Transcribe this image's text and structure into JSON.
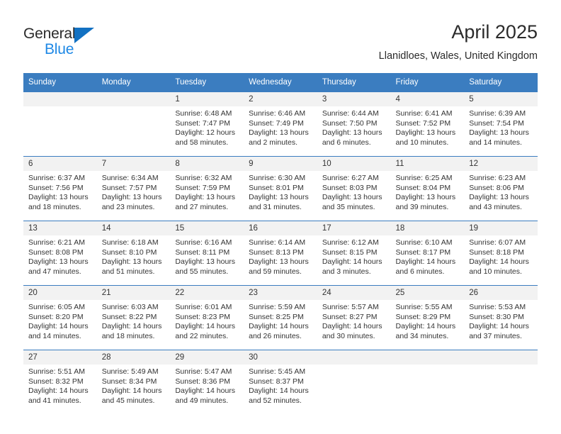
{
  "brand": {
    "name_primary": "General",
    "name_secondary": "Blue",
    "accent_color": "#1271c2",
    "secondary_color": "#1e88e5"
  },
  "header": {
    "title": "April 2025",
    "subtitle": "Llanidloes, Wales, United Kingdom"
  },
  "calendar": {
    "header_bg": "#3b7dc0",
    "daynum_bg": "#f2f2f2",
    "weekday_headers": [
      "Sunday",
      "Monday",
      "Tuesday",
      "Wednesday",
      "Thursday",
      "Friday",
      "Saturday"
    ],
    "weeks": [
      [
        {
          "day": "",
          "sunrise": "",
          "sunset": "",
          "daylight_a": "",
          "daylight_b": ""
        },
        {
          "day": "",
          "sunrise": "",
          "sunset": "",
          "daylight_a": "",
          "daylight_b": ""
        },
        {
          "day": "1",
          "sunrise": "Sunrise: 6:48 AM",
          "sunset": "Sunset: 7:47 PM",
          "daylight_a": "Daylight: 12 hours",
          "daylight_b": "and 58 minutes."
        },
        {
          "day": "2",
          "sunrise": "Sunrise: 6:46 AM",
          "sunset": "Sunset: 7:49 PM",
          "daylight_a": "Daylight: 13 hours",
          "daylight_b": "and 2 minutes."
        },
        {
          "day": "3",
          "sunrise": "Sunrise: 6:44 AM",
          "sunset": "Sunset: 7:50 PM",
          "daylight_a": "Daylight: 13 hours",
          "daylight_b": "and 6 minutes."
        },
        {
          "day": "4",
          "sunrise": "Sunrise: 6:41 AM",
          "sunset": "Sunset: 7:52 PM",
          "daylight_a": "Daylight: 13 hours",
          "daylight_b": "and 10 minutes."
        },
        {
          "day": "5",
          "sunrise": "Sunrise: 6:39 AM",
          "sunset": "Sunset: 7:54 PM",
          "daylight_a": "Daylight: 13 hours",
          "daylight_b": "and 14 minutes."
        }
      ],
      [
        {
          "day": "6",
          "sunrise": "Sunrise: 6:37 AM",
          "sunset": "Sunset: 7:56 PM",
          "daylight_a": "Daylight: 13 hours",
          "daylight_b": "and 18 minutes."
        },
        {
          "day": "7",
          "sunrise": "Sunrise: 6:34 AM",
          "sunset": "Sunset: 7:57 PM",
          "daylight_a": "Daylight: 13 hours",
          "daylight_b": "and 23 minutes."
        },
        {
          "day": "8",
          "sunrise": "Sunrise: 6:32 AM",
          "sunset": "Sunset: 7:59 PM",
          "daylight_a": "Daylight: 13 hours",
          "daylight_b": "and 27 minutes."
        },
        {
          "day": "9",
          "sunrise": "Sunrise: 6:30 AM",
          "sunset": "Sunset: 8:01 PM",
          "daylight_a": "Daylight: 13 hours",
          "daylight_b": "and 31 minutes."
        },
        {
          "day": "10",
          "sunrise": "Sunrise: 6:27 AM",
          "sunset": "Sunset: 8:03 PM",
          "daylight_a": "Daylight: 13 hours",
          "daylight_b": "and 35 minutes."
        },
        {
          "day": "11",
          "sunrise": "Sunrise: 6:25 AM",
          "sunset": "Sunset: 8:04 PM",
          "daylight_a": "Daylight: 13 hours",
          "daylight_b": "and 39 minutes."
        },
        {
          "day": "12",
          "sunrise": "Sunrise: 6:23 AM",
          "sunset": "Sunset: 8:06 PM",
          "daylight_a": "Daylight: 13 hours",
          "daylight_b": "and 43 minutes."
        }
      ],
      [
        {
          "day": "13",
          "sunrise": "Sunrise: 6:21 AM",
          "sunset": "Sunset: 8:08 PM",
          "daylight_a": "Daylight: 13 hours",
          "daylight_b": "and 47 minutes."
        },
        {
          "day": "14",
          "sunrise": "Sunrise: 6:18 AM",
          "sunset": "Sunset: 8:10 PM",
          "daylight_a": "Daylight: 13 hours",
          "daylight_b": "and 51 minutes."
        },
        {
          "day": "15",
          "sunrise": "Sunrise: 6:16 AM",
          "sunset": "Sunset: 8:11 PM",
          "daylight_a": "Daylight: 13 hours",
          "daylight_b": "and 55 minutes."
        },
        {
          "day": "16",
          "sunrise": "Sunrise: 6:14 AM",
          "sunset": "Sunset: 8:13 PM",
          "daylight_a": "Daylight: 13 hours",
          "daylight_b": "and 59 minutes."
        },
        {
          "day": "17",
          "sunrise": "Sunrise: 6:12 AM",
          "sunset": "Sunset: 8:15 PM",
          "daylight_a": "Daylight: 14 hours",
          "daylight_b": "and 3 minutes."
        },
        {
          "day": "18",
          "sunrise": "Sunrise: 6:10 AM",
          "sunset": "Sunset: 8:17 PM",
          "daylight_a": "Daylight: 14 hours",
          "daylight_b": "and 6 minutes."
        },
        {
          "day": "19",
          "sunrise": "Sunrise: 6:07 AM",
          "sunset": "Sunset: 8:18 PM",
          "daylight_a": "Daylight: 14 hours",
          "daylight_b": "and 10 minutes."
        }
      ],
      [
        {
          "day": "20",
          "sunrise": "Sunrise: 6:05 AM",
          "sunset": "Sunset: 8:20 PM",
          "daylight_a": "Daylight: 14 hours",
          "daylight_b": "and 14 minutes."
        },
        {
          "day": "21",
          "sunrise": "Sunrise: 6:03 AM",
          "sunset": "Sunset: 8:22 PM",
          "daylight_a": "Daylight: 14 hours",
          "daylight_b": "and 18 minutes."
        },
        {
          "day": "22",
          "sunrise": "Sunrise: 6:01 AM",
          "sunset": "Sunset: 8:23 PM",
          "daylight_a": "Daylight: 14 hours",
          "daylight_b": "and 22 minutes."
        },
        {
          "day": "23",
          "sunrise": "Sunrise: 5:59 AM",
          "sunset": "Sunset: 8:25 PM",
          "daylight_a": "Daylight: 14 hours",
          "daylight_b": "and 26 minutes."
        },
        {
          "day": "24",
          "sunrise": "Sunrise: 5:57 AM",
          "sunset": "Sunset: 8:27 PM",
          "daylight_a": "Daylight: 14 hours",
          "daylight_b": "and 30 minutes."
        },
        {
          "day": "25",
          "sunrise": "Sunrise: 5:55 AM",
          "sunset": "Sunset: 8:29 PM",
          "daylight_a": "Daylight: 14 hours",
          "daylight_b": "and 34 minutes."
        },
        {
          "day": "26",
          "sunrise": "Sunrise: 5:53 AM",
          "sunset": "Sunset: 8:30 PM",
          "daylight_a": "Daylight: 14 hours",
          "daylight_b": "and 37 minutes."
        }
      ],
      [
        {
          "day": "27",
          "sunrise": "Sunrise: 5:51 AM",
          "sunset": "Sunset: 8:32 PM",
          "daylight_a": "Daylight: 14 hours",
          "daylight_b": "and 41 minutes."
        },
        {
          "day": "28",
          "sunrise": "Sunrise: 5:49 AM",
          "sunset": "Sunset: 8:34 PM",
          "daylight_a": "Daylight: 14 hours",
          "daylight_b": "and 45 minutes."
        },
        {
          "day": "29",
          "sunrise": "Sunrise: 5:47 AM",
          "sunset": "Sunset: 8:36 PM",
          "daylight_a": "Daylight: 14 hours",
          "daylight_b": "and 49 minutes."
        },
        {
          "day": "30",
          "sunrise": "Sunrise: 5:45 AM",
          "sunset": "Sunset: 8:37 PM",
          "daylight_a": "Daylight: 14 hours",
          "daylight_b": "and 52 minutes."
        },
        {
          "day": "",
          "sunrise": "",
          "sunset": "",
          "daylight_a": "",
          "daylight_b": ""
        },
        {
          "day": "",
          "sunrise": "",
          "sunset": "",
          "daylight_a": "",
          "daylight_b": ""
        },
        {
          "day": "",
          "sunrise": "",
          "sunset": "",
          "daylight_a": "",
          "daylight_b": ""
        }
      ]
    ]
  }
}
